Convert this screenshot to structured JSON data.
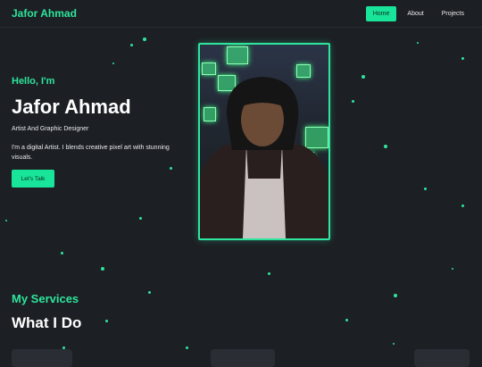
{
  "brand": {
    "name": "Jafor Ahmad",
    "accent": "#2ee59d",
    "background": "#1c1f23"
  },
  "nav": {
    "items": [
      "Home",
      "About",
      "Projects"
    ],
    "active": "Home"
  },
  "hero": {
    "greeting": "Hello, I'm",
    "name": "Jafor Ahmad",
    "role": "Artist And Graphic Designer",
    "description": "I'm a digital Artist. I blends creative pixel art with stunning visuals.",
    "cta_label": "Let's Talk"
  },
  "services": {
    "eyebrow": "My Services",
    "heading": "What I Do"
  }
}
